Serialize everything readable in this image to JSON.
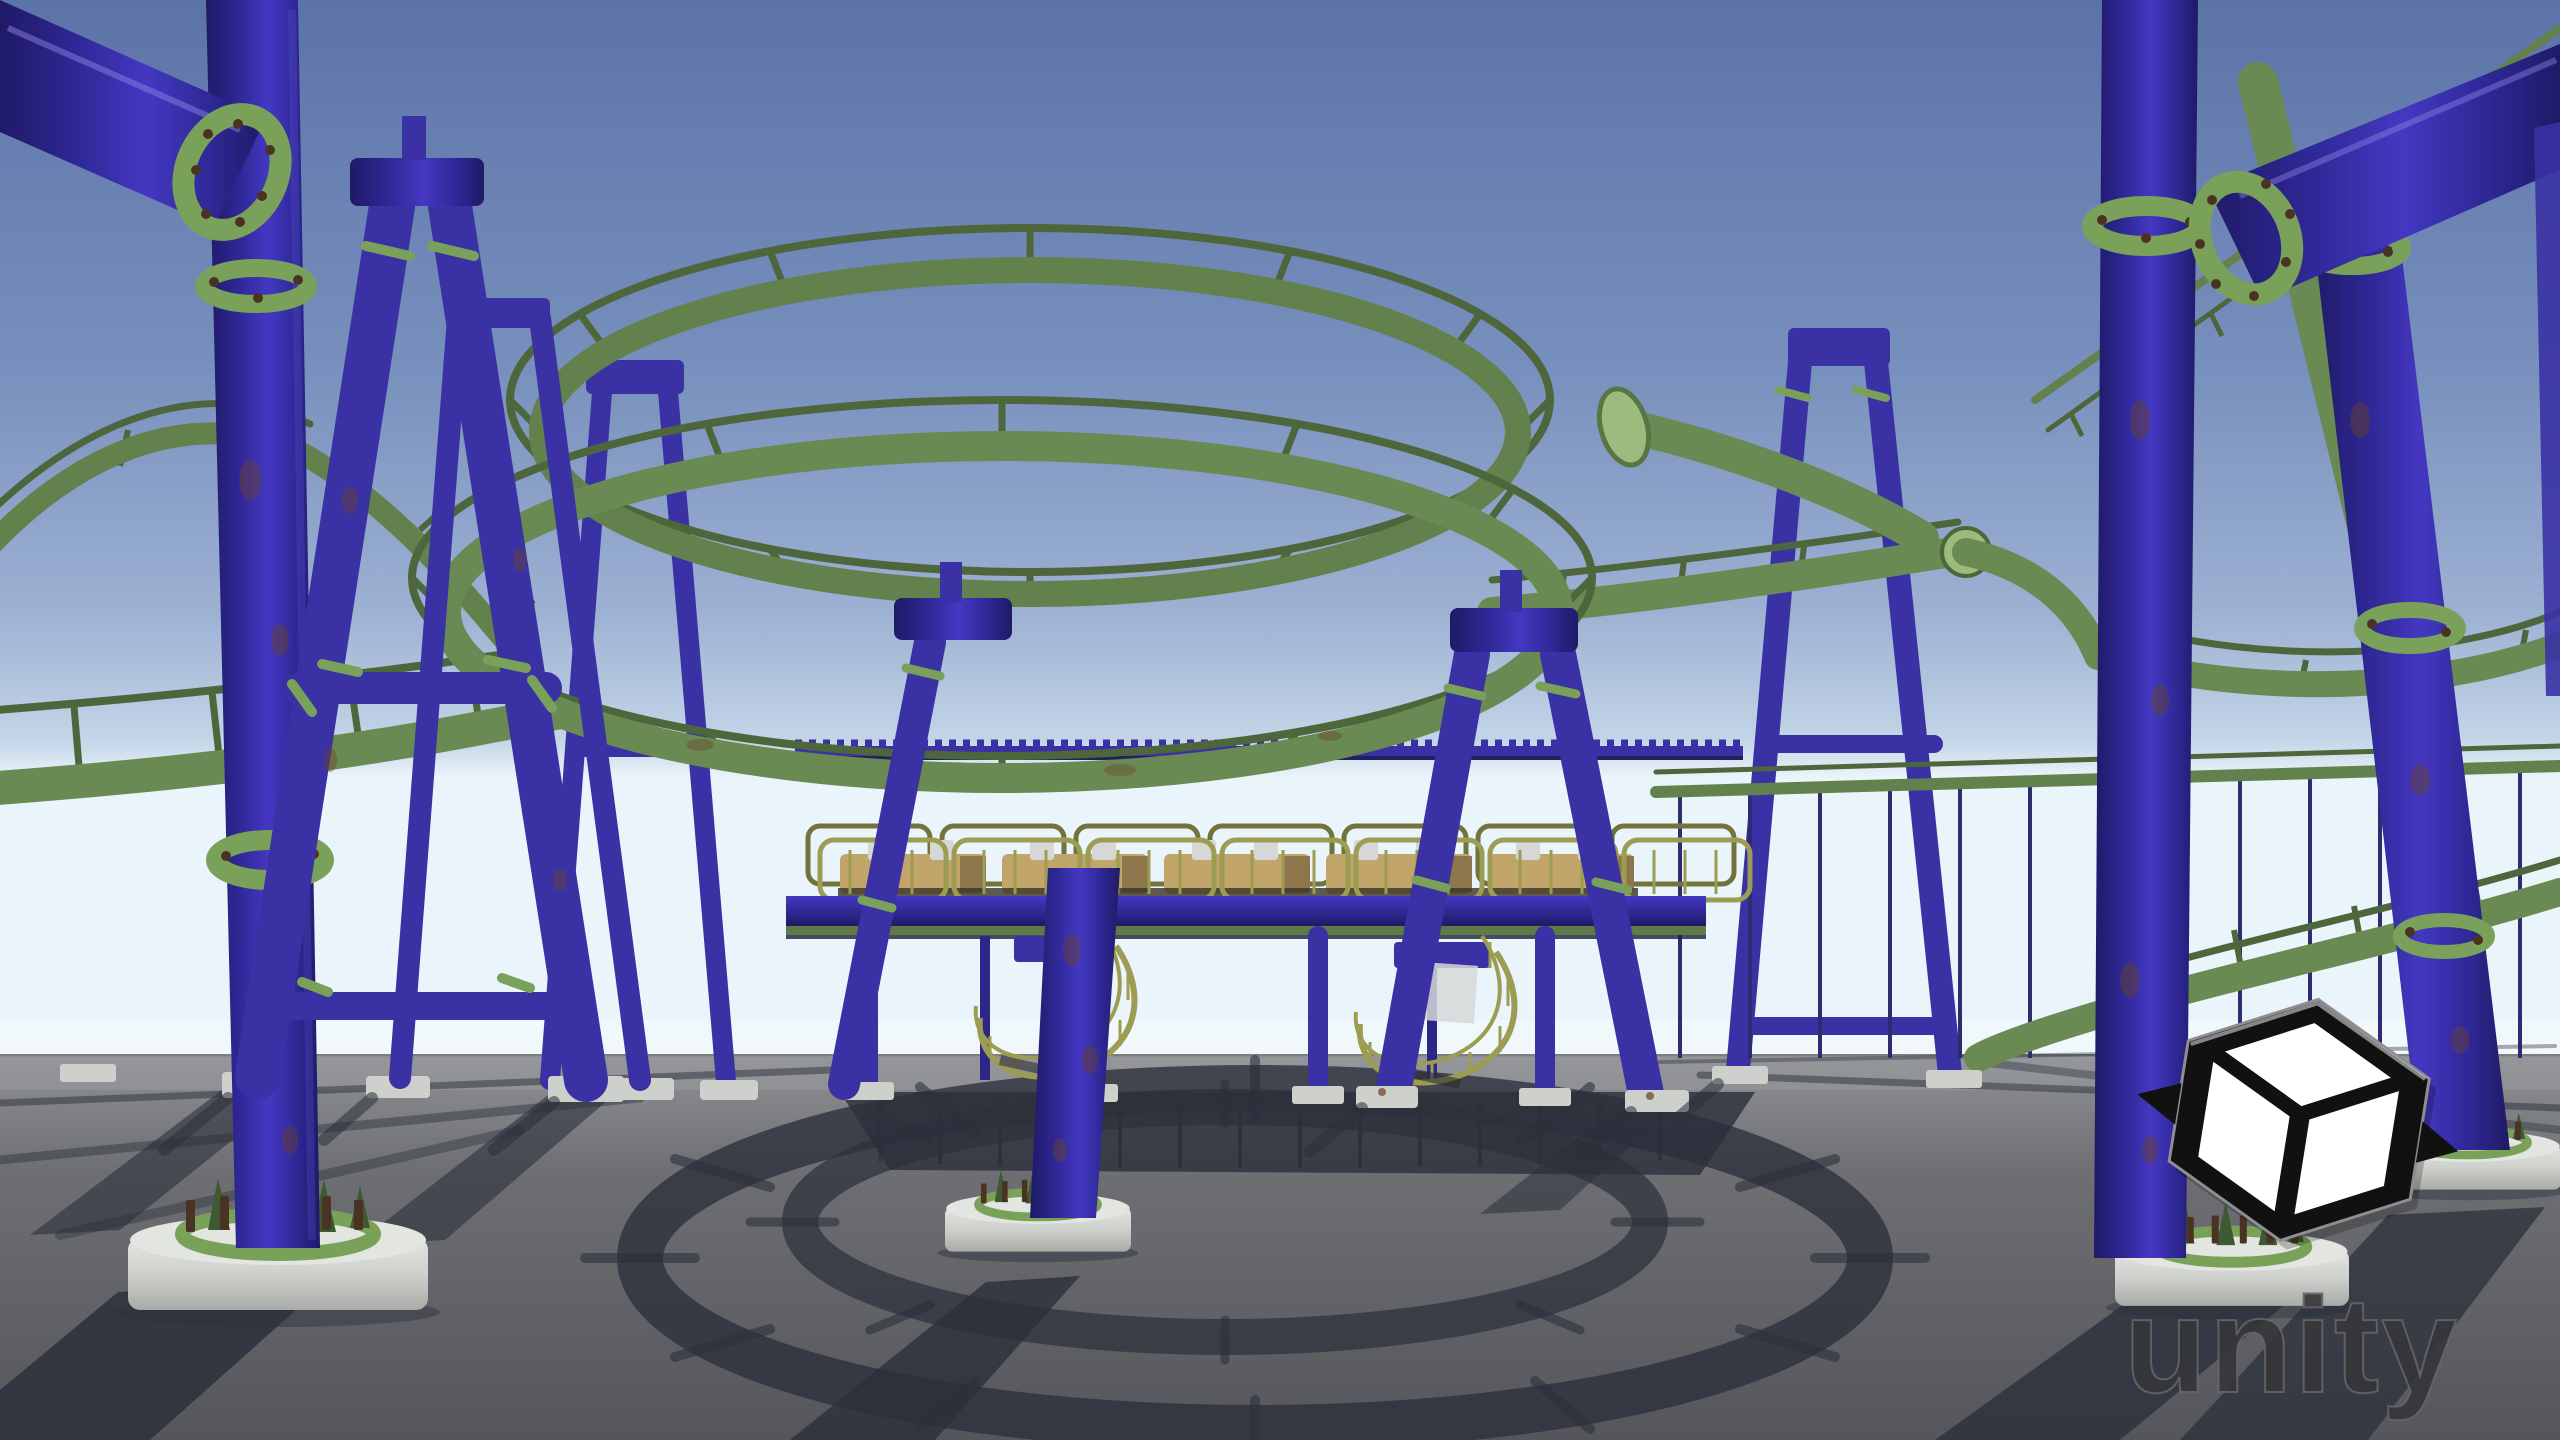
{
  "scene": {
    "type": "3d-render-screenshot",
    "engine": "Unity",
    "subject": "Compact spinning roller coaster with green tube track and purple tubular supports",
    "elements": {
      "track": "green pipe spine with thin upper running rail connected by spokes, double helix in center, hump on left, descending helix on right",
      "supports": "purple cylindrical pillars and A-frames with green bolted flange collars",
      "station": "elevated platform with corrugated edge, parked train of tan cars with white headrests, olive safety railings, two spiral exit stairs",
      "ground": "flat gray plane with concrete footings and long cast shadows including helix ring shadows",
      "sky": "clear blue gradient sky, bright haze at horizon"
    },
    "counts": {
      "train_cars": 5,
      "railing_panels": 7,
      "spiral_stairs": 2,
      "large_pillars": 4
    },
    "watermark": {
      "wordmark": "unity",
      "logo": "unity-cube-logo"
    }
  },
  "palette": {
    "sky_top": "#5c73a8",
    "sky_mid": "#7890bd",
    "sky_low": "#9db1d3",
    "sky_haze": "#c3d5e7",
    "sky_horizon": "#eaf4fb",
    "ground_far": "#909195",
    "ground_mid": "#6e6f73",
    "ground_near": "#55565b",
    "shadow": "#2b303b",
    "track_green": "#6a8a54",
    "track_green_far": "#62814d",
    "track_green_dark": "#4e663b",
    "track_green_light": "#9cbb7e",
    "flange_green": "#7aa15a",
    "purple_light": "#4438c2",
    "purple_mid": "#2e2794",
    "purple_dark": "#1f1a66",
    "purple_flat": "#3a32a4",
    "railing_olive": "#9c9c52",
    "railing_olive_dark": "#72723c",
    "train_tan": "#c2a56b",
    "train_tan_dark": "#7c6742",
    "headrest_white": "#d6d8d8",
    "concrete": "#ced0cb",
    "concrete_light": "#e3e5e0",
    "concrete_dark": "#a9aba6",
    "rust": "#6b4226",
    "bolt_brown": "#4a3322",
    "logo_black": "#111111",
    "logo_face": "#ffffff",
    "wordmark_gray": "#36363a",
    "wordmark_edge": "#64646a"
  }
}
